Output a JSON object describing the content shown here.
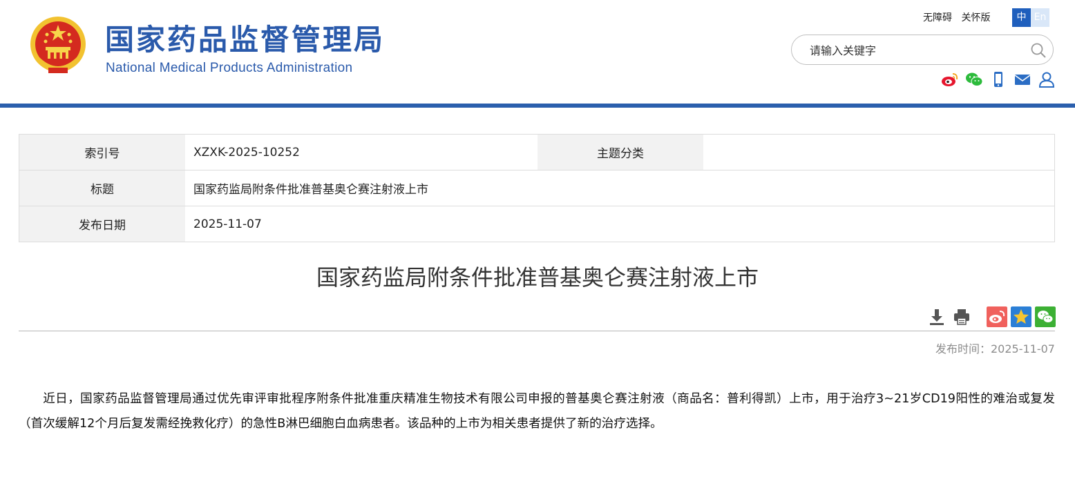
{
  "header": {
    "logo_cn": "国家药品监督管理局",
    "logo_en": "National Medical Products Administration",
    "links": [
      "无障碍",
      "关怀版"
    ],
    "lang_zh": "中",
    "lang_en": "En",
    "search_placeholder": "请输入关键字",
    "social_icons": [
      "weibo-icon",
      "wechat-icon",
      "mobile-icon",
      "mail-icon",
      "user-icon"
    ],
    "accent_color": "#2b5fad"
  },
  "meta": {
    "index_label": "索引号",
    "index_value": "XZXK-2025-10252",
    "topic_label": "主题分类",
    "topic_value": "",
    "title_label": "标题",
    "title_value": "国家药监局附条件批准普基奥仑赛注射液上市",
    "date_label": "发布日期",
    "date_value": "2025-11-07"
  },
  "article": {
    "title": "国家药监局附条件批准普基奥仑赛注射液上市",
    "tool_icons": [
      "download-icon",
      "print-icon",
      "weibo-share-icon",
      "favorite-star-icon",
      "wechat-share-icon"
    ],
    "publish_time": "发布时间：2025-11-07",
    "body": "近日，国家药品监督管理局通过优先审评审批程序附条件批准重庆精准生物技术有限公司申报的普基奥仑赛注射液（商品名：普利得凯）上市，用于治疗3~21岁CD19阳性的难治或复发（首次缓解12个月后复发需经挽救化疗）的急性B淋巴细胞白血病患者。该品种的上市为相关患者提供了新的治疗选择。"
  }
}
